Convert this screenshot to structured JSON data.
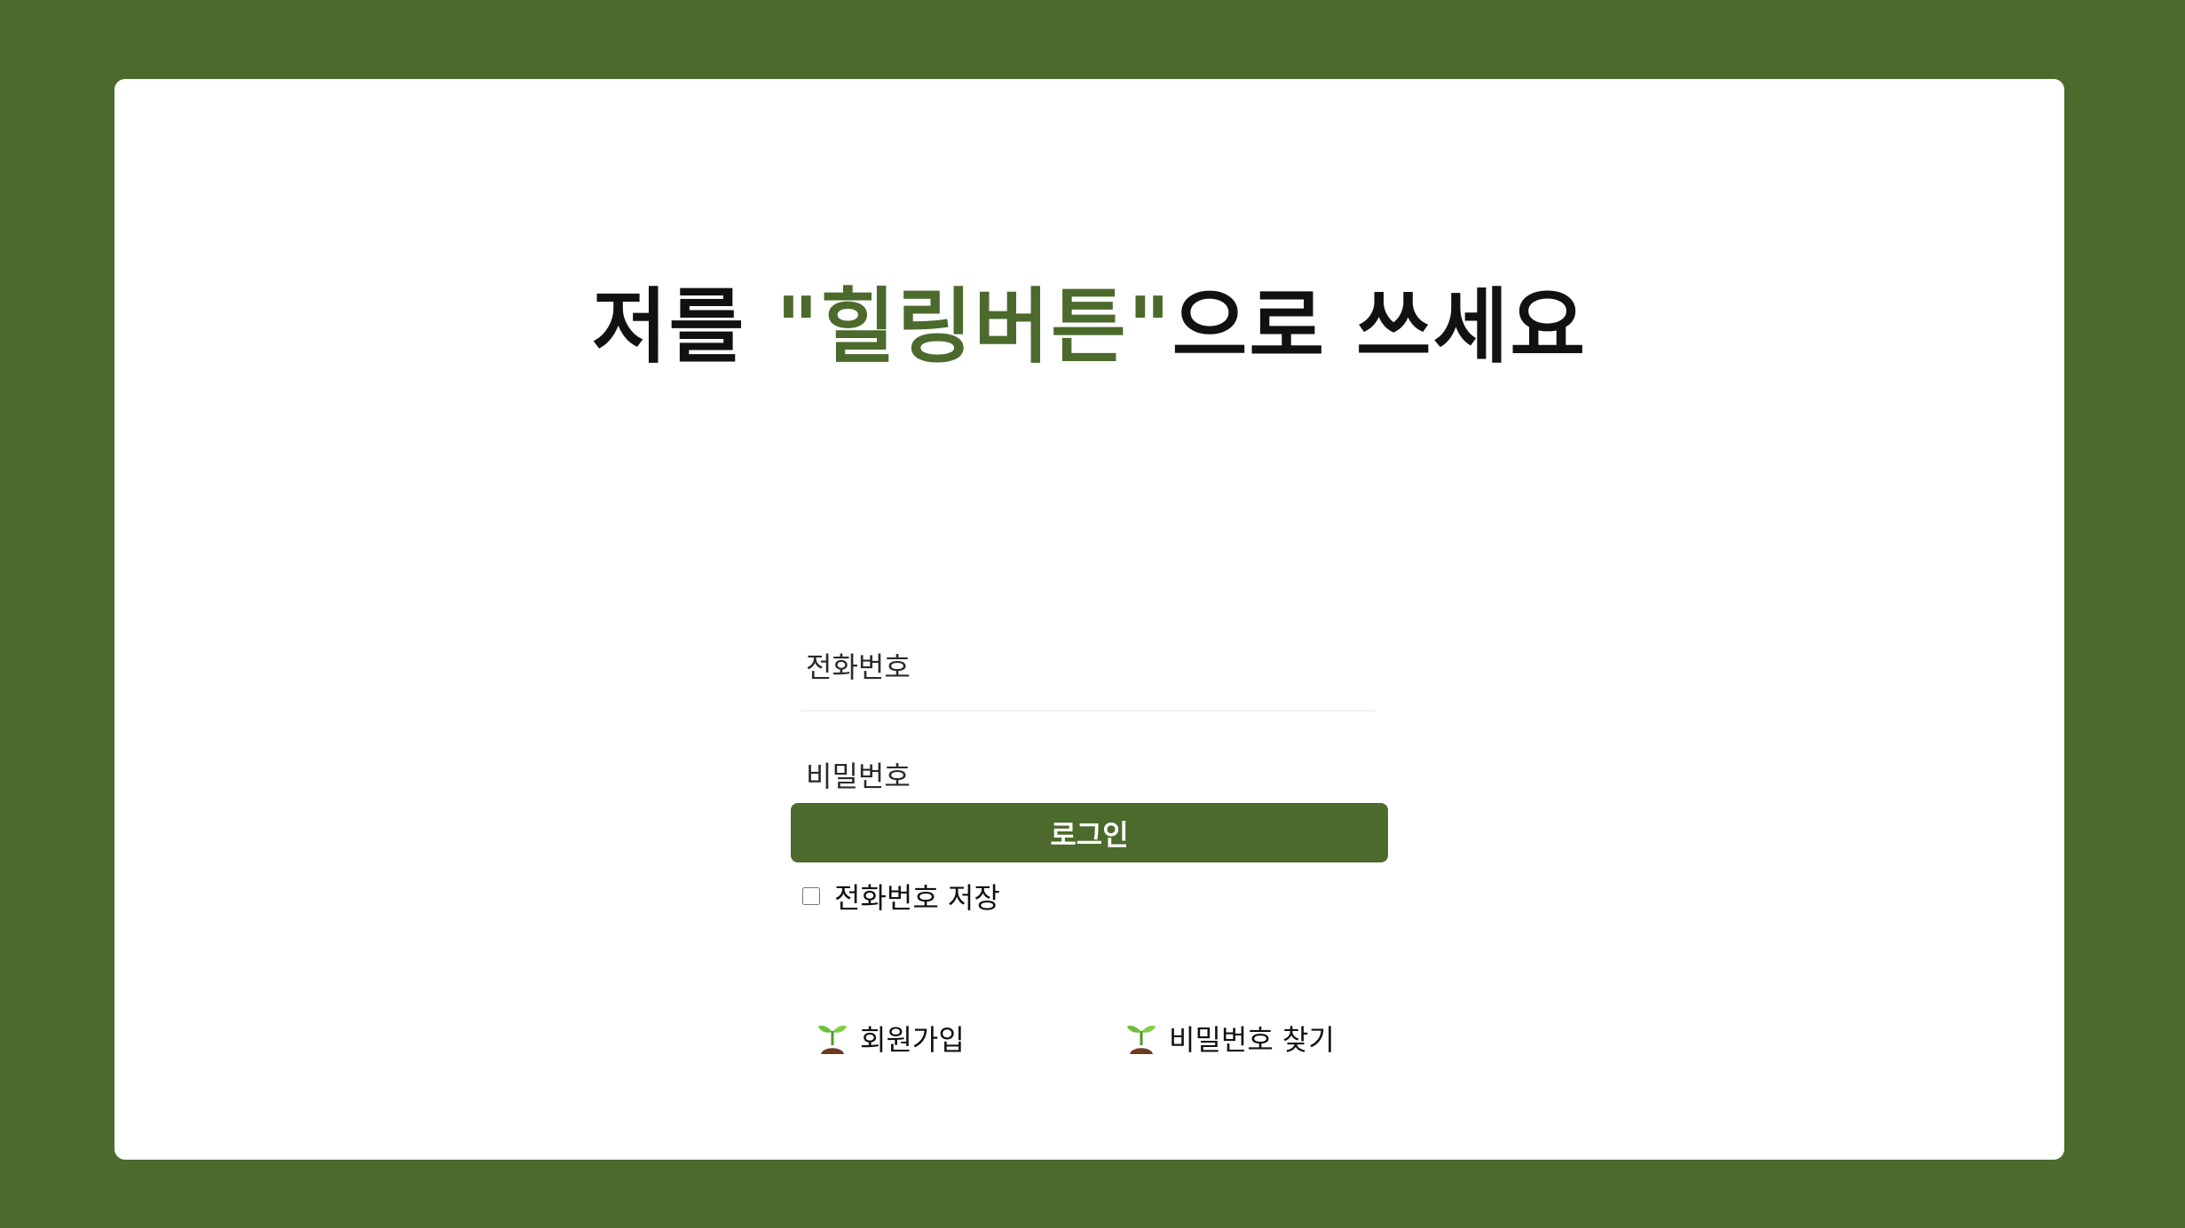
{
  "colors": {
    "background": "#4b6a2c",
    "card": "#ffffff",
    "accent": "#4b6a2c"
  },
  "title": {
    "prefix": "저를 ",
    "highlight": "\"힐링버튼\"",
    "suffix": "으로 쓰세요"
  },
  "form": {
    "phone_placeholder": "전화번호",
    "password_placeholder": "비밀번호",
    "login_label": "로그인",
    "save_phone_label": "전화번호 저장",
    "save_phone_checked": false
  },
  "links": {
    "icon": "sprout-icon",
    "signup_label": "회원가입",
    "find_password_label": "비밀번호 찾기"
  }
}
